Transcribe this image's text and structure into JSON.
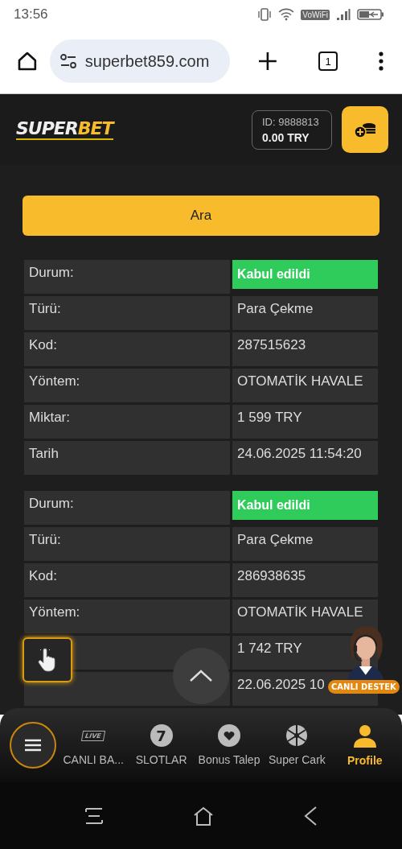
{
  "status_bar": {
    "time": "13:56",
    "network_badge": "VoWiFi"
  },
  "browser": {
    "url": "superbet859.com",
    "tab_count": "1"
  },
  "header": {
    "logo_left": "SUPER",
    "logo_right": "BET",
    "account_id": "ID: 9888813",
    "balance": "0.00 TRY"
  },
  "search_button": "Ara",
  "transactions": [
    {
      "rows": [
        {
          "label": "Durum:",
          "value": "Kabul edildi",
          "kind": "status"
        },
        {
          "label": "Türü:",
          "value": "Para Çekme",
          "kind": "text"
        },
        {
          "label": "Kod:",
          "value": "287515623",
          "kind": "text"
        },
        {
          "label": "Yöntem:",
          "value": "OTOMATİK HAVALE",
          "kind": "text"
        },
        {
          "label": "Miktar:",
          "value": "1 599 TRY",
          "kind": "text"
        },
        {
          "label": "Tarih",
          "value": "24.06.2025 11:54:20",
          "kind": "text"
        }
      ]
    },
    {
      "rows": [
        {
          "label": "Durum:",
          "value": "Kabul edildi",
          "kind": "status"
        },
        {
          "label": "Türü:",
          "value": "Para Çekme",
          "kind": "text"
        },
        {
          "label": "Kod:",
          "value": "286938635",
          "kind": "text"
        },
        {
          "label": "Yöntem:",
          "value": "OTOMATİK HAVALE",
          "kind": "text"
        },
        {
          "value": "1 742 TRY",
          "kind": "text"
        },
        {
          "value": "22.06.2025 10",
          "kind": "text"
        }
      ]
    }
  ],
  "live_support": {
    "label": "CANLI DESTEK"
  },
  "bottom_nav": [
    {
      "label": "CANLI BA...",
      "icon_text": "LIVE",
      "selected": false
    },
    {
      "label": "SLOTLAR",
      "icon_text": "7",
      "selected": false
    },
    {
      "label": "Bonus Talep",
      "selected": false
    },
    {
      "label": "Super Cark",
      "selected": false
    },
    {
      "label": "Profile",
      "selected": true
    }
  ]
}
